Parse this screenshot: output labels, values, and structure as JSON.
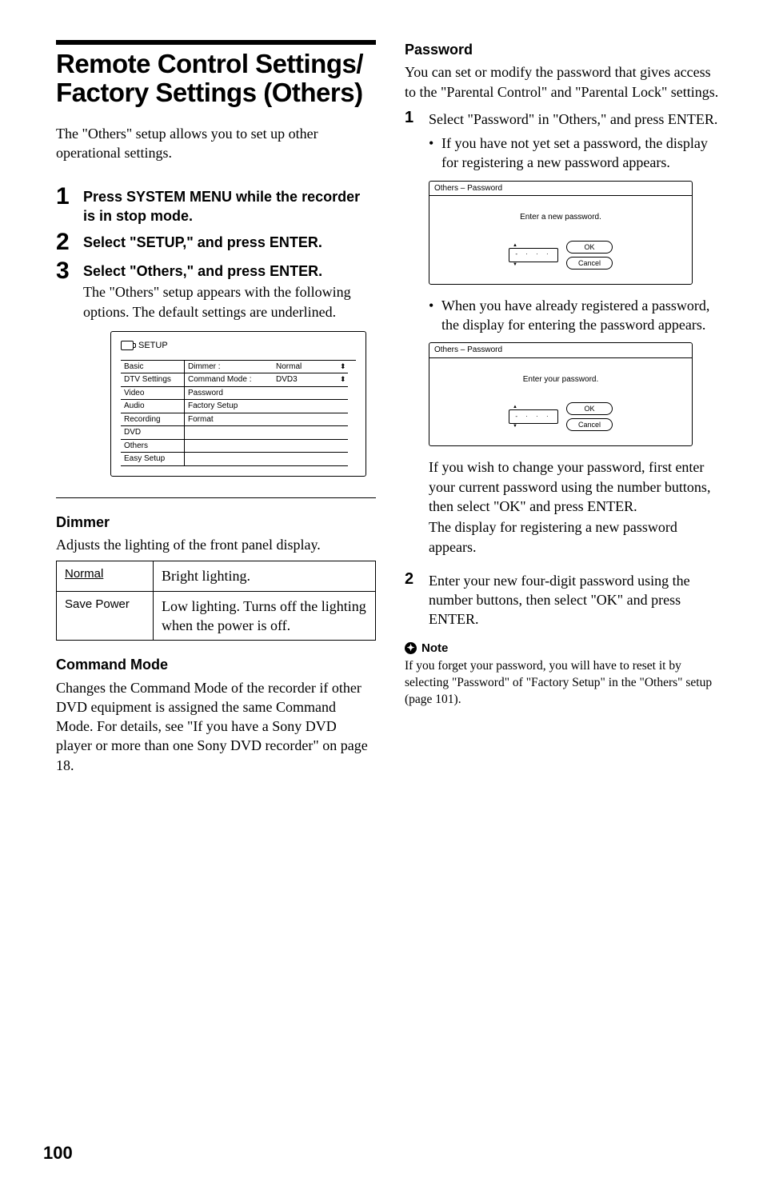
{
  "page_number": "100",
  "left": {
    "title_line1": "Remote Control Settings/",
    "title_line2": "Factory Settings (Others)",
    "intro": "The \"Others\" setup allows you to set up other operational settings.",
    "steps": [
      {
        "num": "1",
        "title": "Press SYSTEM MENU while the recorder is in stop mode."
      },
      {
        "num": "2",
        "title": "Select \"SETUP,\" and press ENTER."
      },
      {
        "num": "3",
        "title": "Select \"Others,\" and press ENTER.",
        "desc": "The \"Others\" setup appears with the following options. The default settings are underlined."
      }
    ],
    "setup_screen": {
      "head": "SETUP",
      "rows": [
        {
          "left": "Basic",
          "mid": "Dimmer :",
          "right": "Normal",
          "arrow": "⬍"
        },
        {
          "left": "DTV Settings",
          "mid": "Command Mode :",
          "right": "DVD3",
          "arrow": "⬍"
        },
        {
          "left": "Video",
          "mid": "Password",
          "right": "",
          "arrow": ""
        },
        {
          "left": "Audio",
          "mid": "Factory Setup",
          "right": "",
          "arrow": ""
        },
        {
          "left": "Recording",
          "mid": "Format",
          "right": "",
          "arrow": ""
        },
        {
          "left": "DVD",
          "mid": "",
          "right": "",
          "arrow": ""
        },
        {
          "left": "Others",
          "mid": "",
          "right": "",
          "arrow": ""
        },
        {
          "left": "Easy Setup",
          "mid": "",
          "right": "",
          "arrow": ""
        }
      ]
    },
    "dimmer": {
      "head": "Dimmer",
      "desc": "Adjusts the lighting of the front panel display.",
      "rows": [
        {
          "key": "Normal",
          "underline": true,
          "val": "Bright lighting."
        },
        {
          "key": "Save Power",
          "underline": false,
          "val": "Low lighting. Turns off the lighting when the power is off."
        }
      ]
    },
    "command": {
      "head": "Command Mode",
      "desc": "Changes the Command Mode of the recorder if other DVD equipment is assigned the same Command Mode. For details, see \"If you have a Sony DVD player or more than one Sony DVD recorder\" on page 18."
    }
  },
  "right": {
    "password": {
      "head": "Password",
      "intro": "You can set or modify the password that gives access to the \"Parental Control\" and \"Parental Lock\" settings.",
      "steps": [
        {
          "num": "1",
          "text": "Select \"Password\" in \"Others,\" and press ENTER.",
          "bullets": [
            "If you have not yet set a password, the display for registering a new password appears."
          ],
          "screen1": {
            "head": "Others – Password",
            "prompt": "Enter a new password.",
            "field": "- · · ·",
            "ok": "OK",
            "cancel": "Cancel"
          },
          "bullets2": [
            "When you have already registered a password, the display for entering the password appears."
          ],
          "screen2": {
            "head": "Others – Password",
            "prompt": "Enter your password.",
            "field": "- · · ·",
            "ok": "OK",
            "cancel": "Cancel"
          },
          "after_para1": "If you wish to change your password, first enter your current password using the number buttons, then select \"OK\" and press ENTER.",
          "after_para2": "The display for registering a new password appears."
        },
        {
          "num": "2",
          "text": "Enter your new four-digit password using the number buttons, then select \"OK\" and press ENTER."
        }
      ],
      "note_head": "Note",
      "note_body": "If you forget your password, you will have to reset it by selecting \"Password\" of \"Factory Setup\" in the \"Others\" setup (page 101)."
    }
  }
}
